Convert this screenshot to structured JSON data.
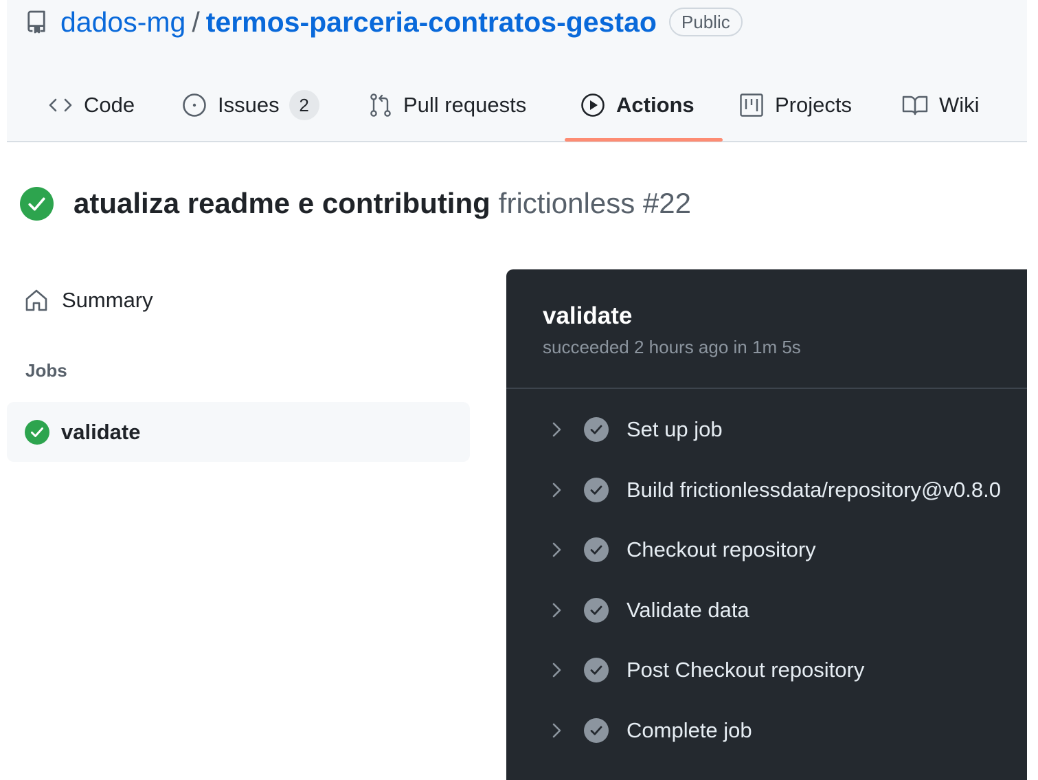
{
  "repo": {
    "owner": "dados-mg",
    "separator": "/",
    "name": "termos-parceria-contratos-gestao",
    "visibility": "Public"
  },
  "tabs": [
    {
      "label": "Code",
      "icon": "code-icon"
    },
    {
      "label": "Issues",
      "icon": "issue-opened-icon",
      "count": "2"
    },
    {
      "label": "Pull requests",
      "icon": "git-pull-request-icon"
    },
    {
      "label": "Actions",
      "icon": "play-icon",
      "active": true
    },
    {
      "label": "Projects",
      "icon": "project-icon"
    },
    {
      "label": "Wiki",
      "icon": "book-icon"
    }
  ],
  "run": {
    "name": "atualiza readme e contributing",
    "workflow": "frictionless #22",
    "status": "success"
  },
  "sidebar": {
    "summary_label": "Summary",
    "jobs_heading": "Jobs",
    "jobs": [
      {
        "name": "validate",
        "status": "success"
      }
    ]
  },
  "job_log": {
    "title": "validate",
    "status_text": "succeeded 2 hours ago in 1m 5s",
    "steps": [
      {
        "label": "Set up job"
      },
      {
        "label": "Build frictionlessdata/repository@v0.8.0"
      },
      {
        "label": "Checkout repository"
      },
      {
        "label": "Validate data"
      },
      {
        "label": "Post Checkout repository"
      },
      {
        "label": "Complete job"
      }
    ]
  },
  "colors": {
    "link": "#0969da",
    "success": "#2da44e",
    "active_tab_underline": "#fd8c73",
    "log_background": "#24292f"
  }
}
